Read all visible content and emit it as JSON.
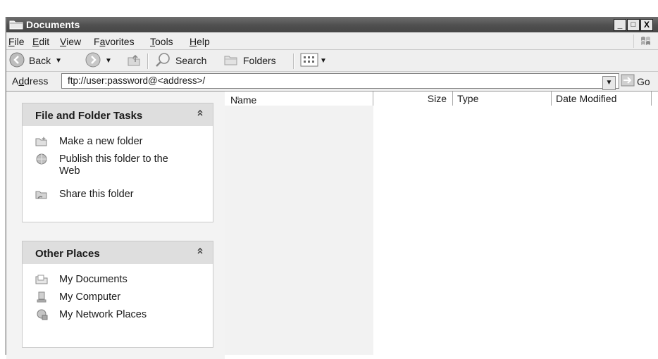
{
  "window": {
    "title": "Documents",
    "buttons": {
      "minimize": "_",
      "maximize": "□",
      "close": "X"
    }
  },
  "menu": {
    "items": [
      {
        "pre": "",
        "u": "F",
        "post": "ile"
      },
      {
        "pre": "",
        "u": "E",
        "post": "dit"
      },
      {
        "pre": "",
        "u": "V",
        "post": "iew"
      },
      {
        "pre": "F",
        "u": "a",
        "post": "vorites"
      },
      {
        "pre": "",
        "u": "T",
        "post": "ools"
      },
      {
        "pre": "",
        "u": "H",
        "post": "elp"
      }
    ]
  },
  "toolbar": {
    "back_label": "Back",
    "search_label": "Search",
    "folders_label": "Folders"
  },
  "address": {
    "label_pre": "A",
    "label_u": "d",
    "label_post": "dress",
    "value": "ftp://user:password@<address>/",
    "go_label": "Go"
  },
  "tasks_panel": {
    "title": "File and Folder Tasks",
    "collapse_glyph": "≈",
    "items": [
      {
        "label": "Make a new folder",
        "icon": "new-folder-icon"
      },
      {
        "label": "Publish this folder to the Web",
        "icon": "publish-web-icon"
      },
      {
        "label": "Share this folder",
        "icon": "share-folder-icon"
      }
    ]
  },
  "places_panel": {
    "title": "Other Places",
    "collapse_glyph": "≈",
    "items": [
      {
        "label": "My Documents",
        "icon": "my-documents-icon"
      },
      {
        "label": "My Computer",
        "icon": "my-computer-icon"
      },
      {
        "label": "My Network Places",
        "icon": "network-places-icon"
      }
    ]
  },
  "list": {
    "columns": [
      "Name",
      "Size",
      "Type",
      "Date Modified"
    ],
    "rows": []
  },
  "colors": {
    "titlebar": "#555555",
    "panel_header": "#dedede",
    "name_column_highlight": "#f2f2f2"
  }
}
